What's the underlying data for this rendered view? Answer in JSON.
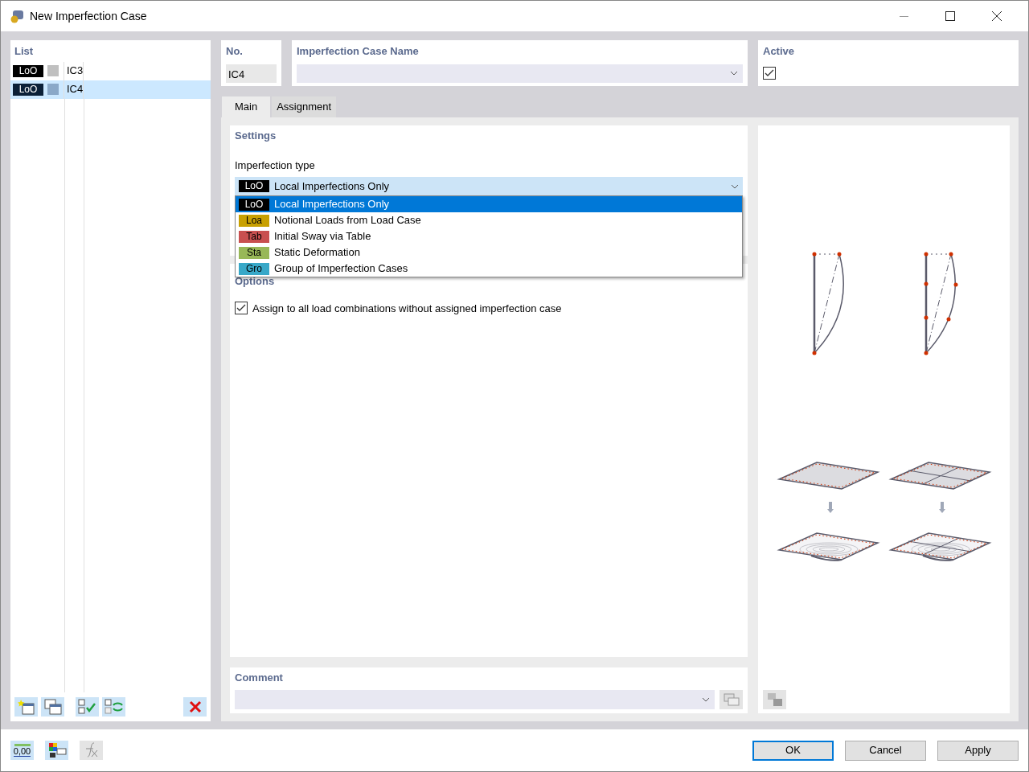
{
  "window": {
    "title": "New Imperfection Case"
  },
  "list": {
    "title": "List",
    "items": [
      {
        "tag": "LoO",
        "color": "#c0c0c0",
        "name": "IC3",
        "selected": false
      },
      {
        "tag": "LoO",
        "color": "#8aa8c8",
        "name": "IC4",
        "selected": true
      }
    ]
  },
  "number": {
    "label": "No.",
    "value": "IC4"
  },
  "case_name": {
    "label": "Imperfection Case Name"
  },
  "active": {
    "label": "Active",
    "checked": true
  },
  "tabs": [
    {
      "label": "Main",
      "selected": true
    },
    {
      "label": "Assignment",
      "selected": false
    }
  ],
  "settings": {
    "title": "Settings",
    "type_label": "Imperfection type",
    "type_value": {
      "tag": "LoO",
      "color": "#000000",
      "label": "Local Imperfections Only"
    },
    "type_options": [
      {
        "tag": "LoO",
        "color": "#000000",
        "label": "Local Imperfections Only",
        "selected": true
      },
      {
        "tag": "Loa",
        "color": "#c8a000",
        "label": "Notional Loads from Load Case",
        "selected": false
      },
      {
        "tag": "Tab",
        "color": "#c85050",
        "label": "Initial Sway via Table",
        "selected": false
      },
      {
        "tag": "Sta",
        "color": "#98b858",
        "label": "Static Deformation",
        "selected": false
      },
      {
        "tag": "Gro",
        "color": "#38a8c8",
        "label": "Group of Imperfection Cases",
        "selected": false
      }
    ]
  },
  "options": {
    "title": "Options",
    "assign": {
      "label": "Assign to all load combinations without assigned imperfection case",
      "checked": true
    }
  },
  "comment": {
    "title": "Comment"
  },
  "footer_tools": {
    "decimals": "0,00"
  },
  "buttons": [
    {
      "label": "OK",
      "default": true
    },
    {
      "label": "Cancel",
      "default": false
    },
    {
      "label": "Apply",
      "default": false
    }
  ]
}
